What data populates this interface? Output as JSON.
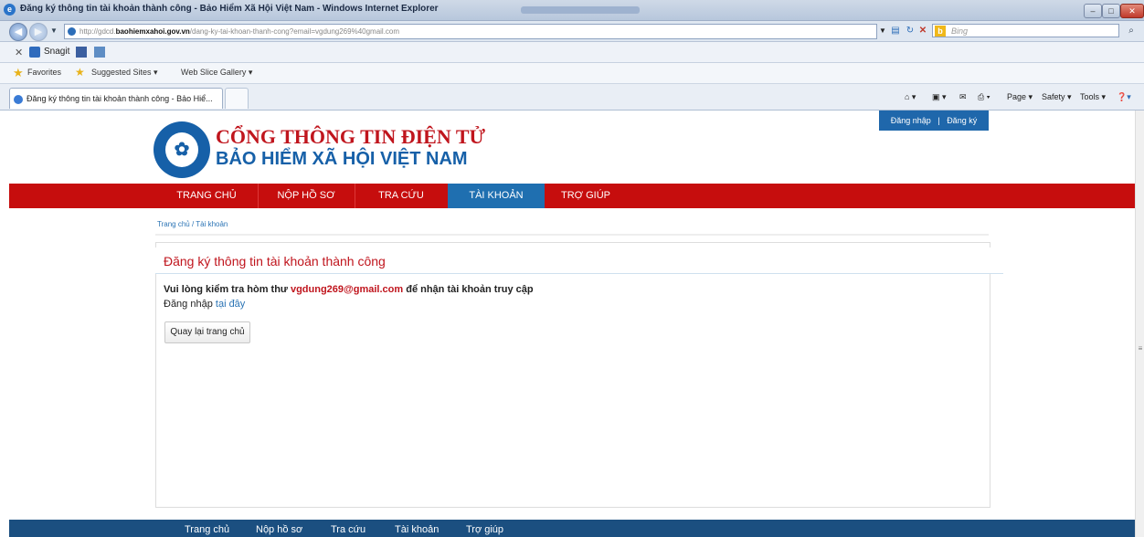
{
  "browser": {
    "title": "Đăng ký thông tin tài khoản thành công - Bảo Hiểm Xã Hội Việt Nam - Windows Internet Explorer",
    "url_prefix": "http://gdcd.",
    "url_domain": "baohiemxahoi.gov.vn",
    "url_suffix": "/dang-ky-tai-khoan-thanh-cong?email=vgdung269%40gmail.com",
    "search_placeholder": "Bing",
    "snagit_label": "Snagit",
    "favorites_label": "Favorites",
    "fav_suggested": "Suggested Sites ▾",
    "fav_webslice": "Web Slice Gallery ▾",
    "tab_title": "Đăng ký thông tin tài khoản thành công - Bảo Hiể...",
    "cmd_page": "Page ▾",
    "cmd_safety": "Safety ▾",
    "cmd_tools": "Tools ▾"
  },
  "site": {
    "line1": "CỔNG THÔNG TIN ĐIỆN TỬ",
    "line2": "BẢO HIỂM XÃ HỘI VIỆT NAM",
    "login": "Đăng nhập",
    "register": "Đăng ký",
    "login_sep": "|"
  },
  "nav": {
    "items": [
      "TRANG CHỦ",
      "NỘP HỒ SƠ",
      "TRA CỨU",
      "TÀI KHOẢN",
      "TRỢ GIÚP"
    ],
    "active_index": 3
  },
  "breadcrumb": "Trang chủ / Tài khoản",
  "panel": {
    "title": "Đăng ký thông tin tài khoản thành công",
    "msg_pre": "Vui lòng kiểm tra hòm thư ",
    "msg_email": "vgdung269@gmail.com",
    "msg_post": " để nhận tài khoản truy cập",
    "login_pre": "Đăng nhập ",
    "login_link": "tại đây",
    "home_button": "Quay lại trang chủ"
  },
  "footer": {
    "items": [
      "Trang chủ",
      "Nộp hồ sơ",
      "Tra cứu",
      "Tài khoản",
      "Trợ giúp"
    ]
  },
  "colors": {
    "nav_red": "#c60d0d",
    "nav_active": "#1f6fb0",
    "footer": "#1b4f80",
    "title_red": "#c0151d"
  }
}
